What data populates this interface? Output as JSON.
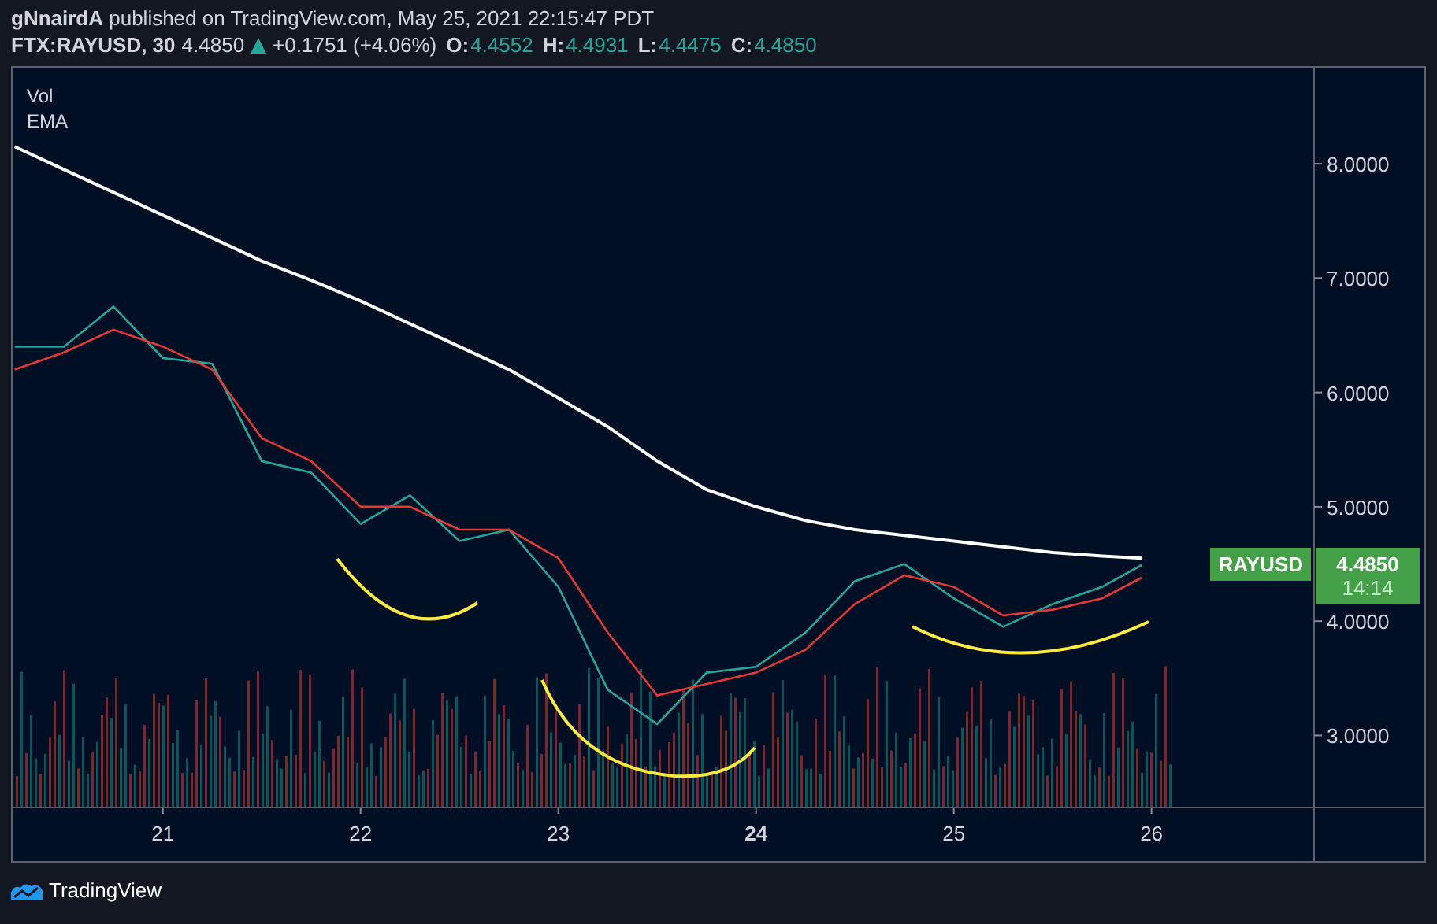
{
  "header": {
    "published_line": "**gNnairdA** published on TradingView.com, May 25, 2021 22:15:47 PDT",
    "symbol": "FTX:RAYUSD, 30",
    "last": "4.4850",
    "rising": true,
    "change": "+0.1751 (+4.06%)",
    "ohlc": [
      {
        "label": "O:",
        "value": "4.4552"
      },
      {
        "label": "H:",
        "value": "4.4931"
      },
      {
        "label": "L:",
        "value": "4.4475"
      },
      {
        "label": "C:",
        "value": "4.4850"
      }
    ]
  },
  "chart": {
    "legend": [
      "Vol",
      "EMA"
    ],
    "price_tag": {
      "symbol": "RAYUSD",
      "price": "4.4850",
      "countdown": "14:14"
    },
    "x_axis_labels": [
      {
        "label": "21",
        "bold": false
      },
      {
        "label": "22",
        "bold": false
      },
      {
        "label": "23",
        "bold": false
      },
      {
        "label": "24",
        "bold": true
      },
      {
        "label": "25",
        "bold": false
      },
      {
        "label": "26",
        "bold": false
      }
    ],
    "chart_data": {
      "type": "line",
      "x": [
        20.25,
        20.5,
        20.75,
        21,
        21.25,
        21.5,
        21.75,
        22,
        22.25,
        22.5,
        22.75,
        23,
        23.25,
        23.5,
        23.75,
        24,
        24.25,
        24.5,
        24.75,
        25,
        25.25,
        25.5,
        25.75,
        25.95
      ],
      "series": [
        {
          "color": "#26a69a",
          "values": [
            6.4,
            6.4,
            6.75,
            6.3,
            6.25,
            5.4,
            5.3,
            4.85,
            5.1,
            4.7,
            4.8,
            4.3,
            3.4,
            3.1,
            3.55,
            3.6,
            3.9,
            4.35,
            4.5,
            4.2,
            3.95,
            4.15,
            4.3,
            4.49
          ]
        },
        {
          "color": "#ffffff",
          "values": [
            8.15,
            7.95,
            7.75,
            7.55,
            7.35,
            7.15,
            6.98,
            6.8,
            6.6,
            6.4,
            6.2,
            5.95,
            5.7,
            5.4,
            5.15,
            5.0,
            4.88,
            4.8,
            4.75,
            4.7,
            4.65,
            4.6,
            4.57,
            4.55
          ]
        },
        {
          "color": "#e53935",
          "values": [
            6.2,
            6.35,
            6.55,
            6.4,
            6.2,
            5.6,
            5.4,
            5.0,
            5.0,
            4.8,
            4.8,
            4.55,
            3.9,
            3.35,
            3.45,
            3.55,
            3.75,
            4.15,
            4.4,
            4.3,
            4.05,
            4.1,
            4.2,
            4.38
          ]
        }
      ],
      "xlim": [
        20.24,
        27.38
      ],
      "ylim": [
        2.37,
        8.84
      ],
      "xticks": [
        21,
        22,
        23,
        24,
        25,
        26
      ],
      "yticks": [
        {
          "value": 3,
          "label": "3.0000"
        },
        {
          "value": 4,
          "label": "4.0000"
        },
        {
          "value": 5,
          "label": "5.0000"
        },
        {
          "value": 6,
          "label": "6.0000"
        },
        {
          "value": 7,
          "label": "7.0000"
        },
        {
          "value": 8,
          "label": "8.0000"
        }
      ]
    }
  },
  "footer": {
    "brand": "TradingView"
  }
}
